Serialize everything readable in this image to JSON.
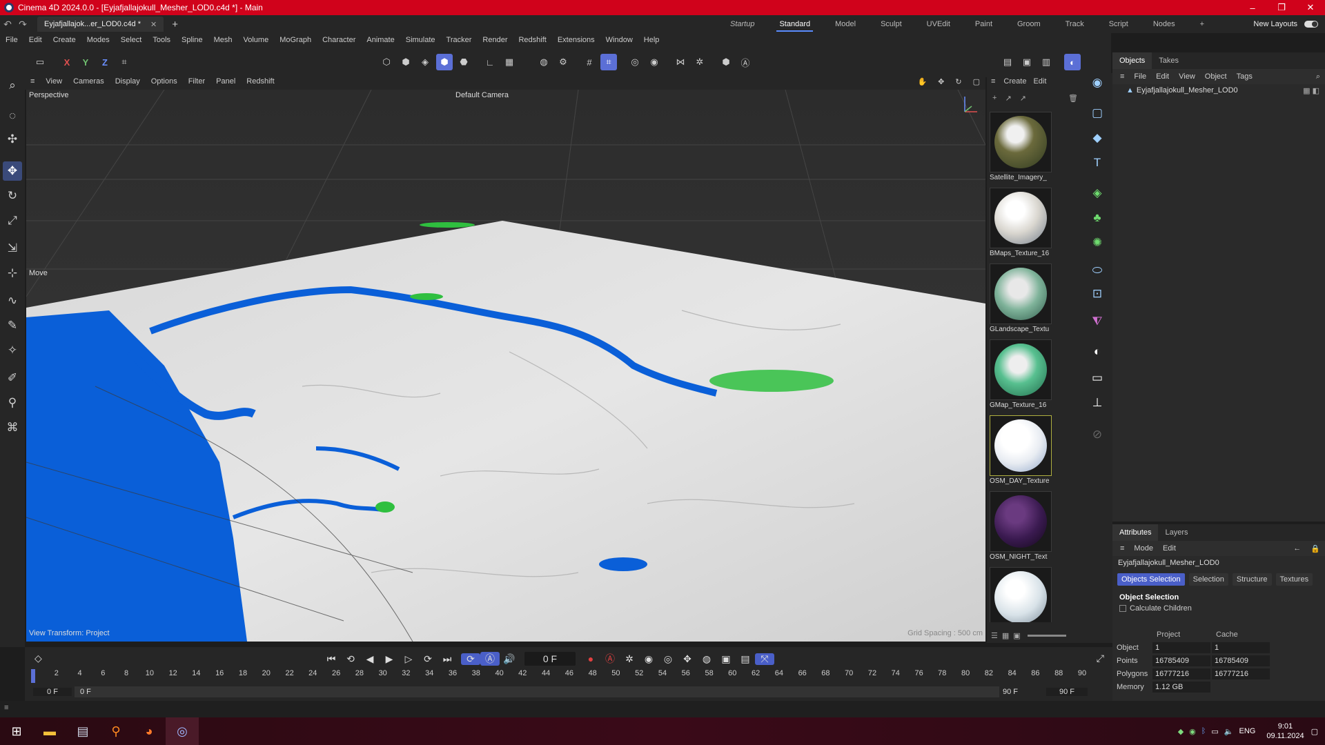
{
  "window": {
    "title": "Cinema 4D 2024.0.0 - [Eyjafjallajokull_Mesher_LOD0.c4d *] - Main",
    "controls": [
      "–",
      "❐",
      "✕"
    ]
  },
  "doc_tab": {
    "label": "Eyjafjallajok...er_LOD0.c4d *"
  },
  "layouts": [
    "Startup",
    "Standard",
    "Model",
    "Sculpt",
    "UVEdit",
    "Paint",
    "Groom",
    "Track",
    "Script",
    "Nodes"
  ],
  "active_layout": "Standard",
  "new_layouts": "New Layouts",
  "menu": [
    "File",
    "Edit",
    "Create",
    "Modes",
    "Select",
    "Tools",
    "Spline",
    "Mesh",
    "Volume",
    "MoGraph",
    "Character",
    "Animate",
    "Simulate",
    "Tracker",
    "Render",
    "Redshift",
    "Extensions",
    "Window",
    "Help"
  ],
  "axis_lock": {
    "x": "X",
    "y": "Y",
    "z": "Z"
  },
  "viewport_menu": [
    "View",
    "Cameras",
    "Display",
    "Options",
    "Filter",
    "Panel",
    "Redshift"
  ],
  "viewport": {
    "name": "Perspective",
    "camera": "Default Camera",
    "tool_hint": "Move",
    "view_transform": "View Transform: Project",
    "grid_spacing": "Grid Spacing : 500 cm"
  },
  "material_manager": {
    "menu": [
      "Create",
      "Edit"
    ],
    "materials": [
      {
        "name": "Satellite_Imagery_",
        "color": "#6b6a3c"
      },
      {
        "name": "BMaps_Texture_16",
        "color": "#d9d6cf"
      },
      {
        "name": "GLandscape_Textu",
        "color": "#7fb39a"
      },
      {
        "name": "GMap_Texture_16",
        "color": "#58c090"
      },
      {
        "name": "OSM_DAY_Texture",
        "color": "#e8ecf2"
      },
      {
        "name": "OSM_NIGHT_Text",
        "color": "#3a1a50"
      },
      {
        "name": "",
        "color": "#d8e2e8"
      }
    ]
  },
  "objects_panel": {
    "tabs": [
      "Objects",
      "Takes"
    ],
    "menu": [
      "File",
      "Edit",
      "View",
      "Object",
      "Tags"
    ],
    "items": [
      {
        "name": "Eyjafjallajokull_Mesher_LOD0"
      }
    ]
  },
  "attributes_panel": {
    "tabs": [
      "Attributes",
      "Layers"
    ],
    "menu": [
      "Mode",
      "Edit"
    ],
    "object_name": "Eyjafjallajokull_Mesher_LOD0",
    "sub_tabs": [
      "Objects Selection",
      "Selection",
      "Structure",
      "Textures"
    ],
    "section": "Object Selection",
    "checkbox": "Calculate Children",
    "columns": [
      "Project",
      "Cache"
    ],
    "rows": [
      {
        "label": "Object",
        "project": "1",
        "cache": "1"
      },
      {
        "label": "Points",
        "project": "16785409",
        "cache": "16785409"
      },
      {
        "label": "Polygons",
        "project": "16777216",
        "cache": "16777216"
      },
      {
        "label": "Memory",
        "project": "1.12 GB",
        "cache": ""
      }
    ]
  },
  "timeline": {
    "current_frame": "0 F",
    "ticks": [
      "0",
      "2",
      "4",
      "6",
      "8",
      "10",
      "12",
      "14",
      "16",
      "18",
      "20",
      "22",
      "24",
      "26",
      "28",
      "30",
      "32",
      "34",
      "36",
      "38",
      "40",
      "42",
      "44",
      "46",
      "48",
      "50",
      "52",
      "54",
      "56",
      "58",
      "60",
      "62",
      "64",
      "66",
      "68",
      "70",
      "72",
      "74",
      "76",
      "78",
      "80",
      "82",
      "84",
      "86",
      "88",
      "90"
    ],
    "range_start": "0 F",
    "range_start2": "0 F",
    "range_end": "90 F",
    "range_end2": "90 F"
  },
  "taskbar": {
    "lang": "ENG",
    "time": "9:01",
    "date": "09.11.2024"
  }
}
